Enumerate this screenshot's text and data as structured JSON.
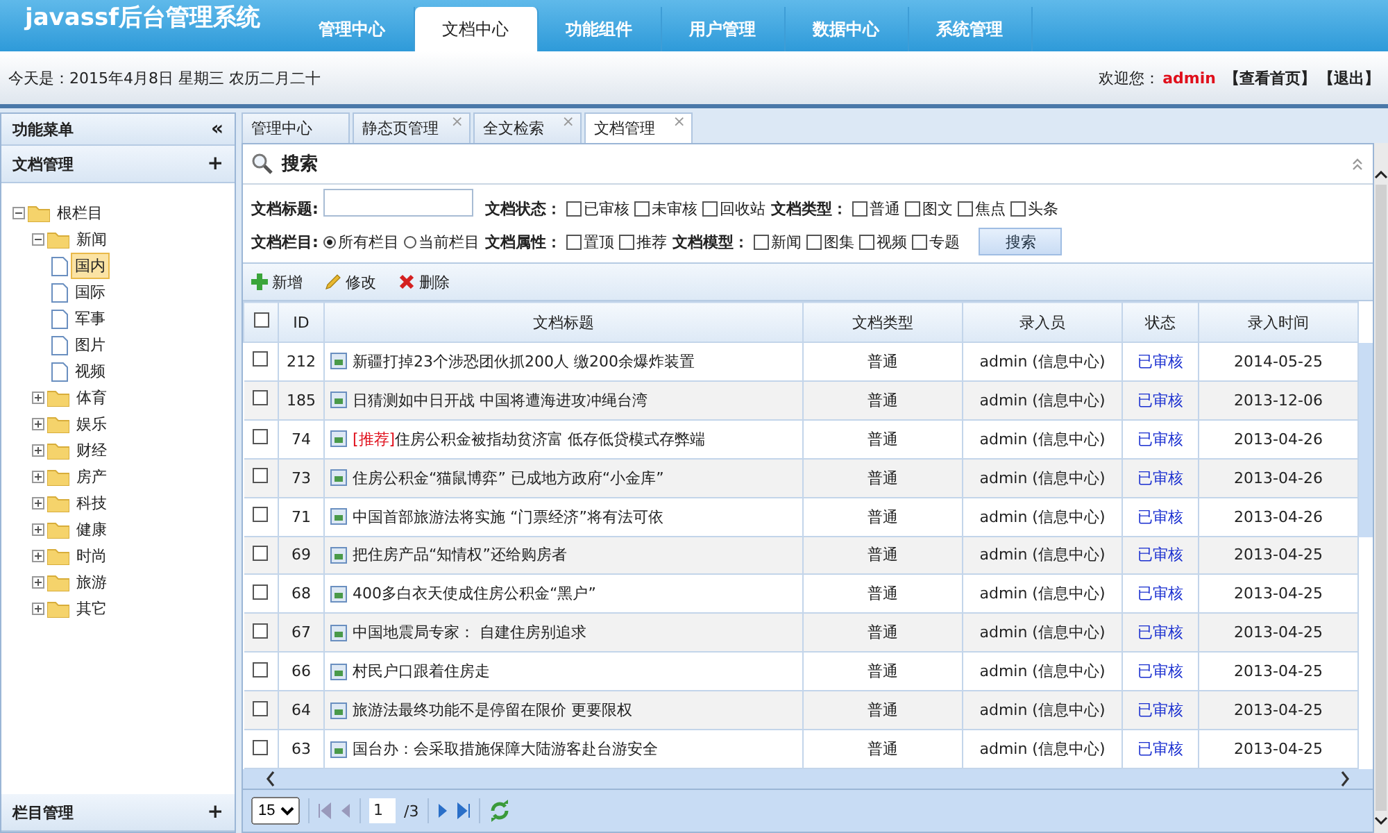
{
  "header": {
    "logo": "javassf后台管理系统",
    "nav": [
      {
        "label": "管理中心",
        "selected": false
      },
      {
        "label": "文档中心",
        "selected": true
      },
      {
        "label": "功能组件",
        "selected": false
      },
      {
        "label": "用户管理",
        "selected": false
      },
      {
        "label": "数据中心",
        "selected": false
      },
      {
        "label": "系统管理",
        "selected": false
      }
    ]
  },
  "infobar": {
    "date": "今天是：2015年4月8日 星期三 农历二月二十",
    "welcome": "欢迎您：",
    "user": "admin",
    "links": [
      "【查看首页】",
      "【退出】"
    ]
  },
  "sidebar": {
    "title": "功能菜单",
    "collapse": "«",
    "section": "文档管理",
    "section_add": "+",
    "footer": "栏目管理",
    "footer_add": "+",
    "tree": [
      {
        "label": "根栏目",
        "expanded": true,
        "kind": "folder",
        "selected": false,
        "children": [
          {
            "label": "新闻",
            "expanded": true,
            "kind": "folder",
            "selected": false,
            "children": [
              {
                "label": "国内",
                "kind": "page",
                "selected": true
              },
              {
                "label": "国际",
                "kind": "page",
                "selected": false
              },
              {
                "label": "军事",
                "kind": "page",
                "selected": false
              },
              {
                "label": "图片",
                "kind": "page",
                "selected": false
              },
              {
                "label": "视频",
                "kind": "page",
                "selected": false
              }
            ]
          },
          {
            "label": "体育",
            "expanded": false,
            "kind": "folder",
            "selected": false
          },
          {
            "label": "娱乐",
            "expanded": false,
            "kind": "folder",
            "selected": false
          },
          {
            "label": "财经",
            "expanded": false,
            "kind": "folder",
            "selected": false
          },
          {
            "label": "房产",
            "expanded": false,
            "kind": "folder",
            "selected": false
          },
          {
            "label": "科技",
            "expanded": false,
            "kind": "folder",
            "selected": false
          },
          {
            "label": "健康",
            "expanded": false,
            "kind": "folder",
            "selected": false
          },
          {
            "label": "时尚",
            "expanded": false,
            "kind": "folder",
            "selected": false
          },
          {
            "label": "旅游",
            "expanded": false,
            "kind": "folder",
            "selected": false
          },
          {
            "label": "其它",
            "expanded": false,
            "kind": "folder",
            "selected": false
          }
        ]
      }
    ]
  },
  "tabs": [
    {
      "label": "管理中心",
      "selected": false
    },
    {
      "label": "静态页管理",
      "close": "×",
      "selected": false
    },
    {
      "label": "全文检索",
      "close": "×",
      "selected": false
    },
    {
      "label": "文档管理",
      "close": "×",
      "selected": true
    }
  ],
  "search": {
    "title": "搜索",
    "title_label": "文档标题:",
    "status_label": "文档状态：",
    "status": [
      {
        "label": "已审核",
        "checked": false
      },
      {
        "label": "未审核",
        "checked": false
      },
      {
        "label": "回收站",
        "checked": false
      }
    ],
    "type_label": "文档类型：",
    "types": [
      {
        "label": "普通",
        "checked": false
      },
      {
        "label": "图文",
        "checked": false
      },
      {
        "label": "焦点",
        "checked": false
      },
      {
        "label": "头条",
        "checked": false
      }
    ],
    "column_label": "文档栏目:",
    "columns": [
      {
        "label": "所有栏目",
        "selected": true
      },
      {
        "label": "当前栏目",
        "selected": false
      }
    ],
    "attr_label": "文档属性：",
    "attrs": [
      {
        "label": "置顶",
        "checked": false
      },
      {
        "label": "推荐",
        "checked": false
      }
    ],
    "model_label": "文档模型：",
    "models": [
      {
        "label": "新闻",
        "checked": false
      },
      {
        "label": "图集",
        "checked": false
      },
      {
        "label": "视频",
        "checked": false
      },
      {
        "label": "专题",
        "checked": false
      }
    ],
    "button": "搜索"
  },
  "toolbar": [
    {
      "kind": "add",
      "label": "新增"
    },
    {
      "kind": "edit",
      "label": "修改"
    },
    {
      "kind": "delete",
      "label": "删除"
    }
  ],
  "table": {
    "select_all_checked": false,
    "columns": [
      "ID",
      "文档标题",
      "文档类型",
      "录入员",
      "状态",
      "录入时间"
    ],
    "rows": [
      {
        "id": "212",
        "title": "新疆打掉23个涉恐团伙抓200人 缴200余爆炸装置",
        "type": "普通",
        "author": "admin (信息中心)",
        "status": "已审核",
        "date": "2014-05-25",
        "checked": false
      },
      {
        "id": "185",
        "title": "日猜测如中日开战 中国将遭海进攻冲绳台湾",
        "type": "普通",
        "author": "admin (信息中心)",
        "status": "已审核",
        "date": "2013-12-06",
        "checked": false
      },
      {
        "id": "74",
        "tag": "[推荐]",
        "title": "住房公积金被指劫贫济富 低存低贷模式存弊端",
        "type": "普通",
        "author": "admin (信息中心)",
        "status": "已审核",
        "date": "2013-04-26",
        "checked": false
      },
      {
        "id": "73",
        "title": "住房公积金“猫鼠博弈” 已成地方政府“小金库”",
        "type": "普通",
        "author": "admin (信息中心)",
        "status": "已审核",
        "date": "2013-04-26",
        "checked": false
      },
      {
        "id": "71",
        "title": "中国首部旅游法将实施 “门票经济”将有法可依",
        "type": "普通",
        "author": "admin (信息中心)",
        "status": "已审核",
        "date": "2013-04-26",
        "checked": false
      },
      {
        "id": "69",
        "title": "把住房产品“知情权”还给购房者",
        "type": "普通",
        "author": "admin (信息中心)",
        "status": "已审核",
        "date": "2013-04-25",
        "checked": false
      },
      {
        "id": "68",
        "title": "400多白衣天使成住房公积金“黑户”",
        "type": "普通",
        "author": "admin (信息中心)",
        "status": "已审核",
        "date": "2013-04-25",
        "checked": false
      },
      {
        "id": "67",
        "title": "中国地震局专家： 自建住房别追求",
        "type": "普通",
        "author": "admin (信息中心)",
        "status": "已审核",
        "date": "2013-04-25",
        "checked": false
      },
      {
        "id": "66",
        "title": "村民户口跟着住房走",
        "type": "普通",
        "author": "admin (信息中心)",
        "status": "已审核",
        "date": "2013-04-25",
        "checked": false
      },
      {
        "id": "64",
        "title": "旅游法最终功能不是停留在限价 更要限权",
        "type": "普通",
        "author": "admin (信息中心)",
        "status": "已审核",
        "date": "2013-04-25",
        "checked": false
      },
      {
        "id": "63",
        "title": "国台办：会采取措施保障大陆游客赴台游安全",
        "type": "普通",
        "author": "admin (信息中心)",
        "status": "已审核",
        "date": "2013-04-25",
        "checked": false
      }
    ]
  },
  "pager": {
    "page_size": "15",
    "page": "1",
    "total": "/3"
  }
}
